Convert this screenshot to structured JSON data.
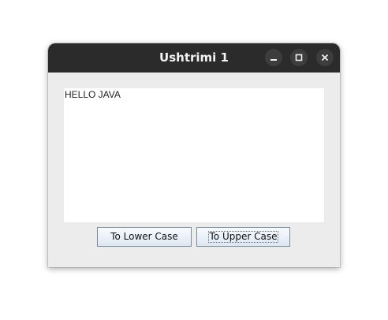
{
  "window": {
    "title": "Ushtrimi 1",
    "controls": [
      "minimize-icon",
      "maximize-icon",
      "close-icon"
    ]
  },
  "textarea": {
    "value": "HELLO JAVA"
  },
  "buttons": {
    "lower_label": "To Lower Case",
    "upper_label": "To Upper Case"
  },
  "colors": {
    "titlebar": "#2b2b2b",
    "window_bg": "#ececec",
    "button_border": "#7a8a99"
  }
}
